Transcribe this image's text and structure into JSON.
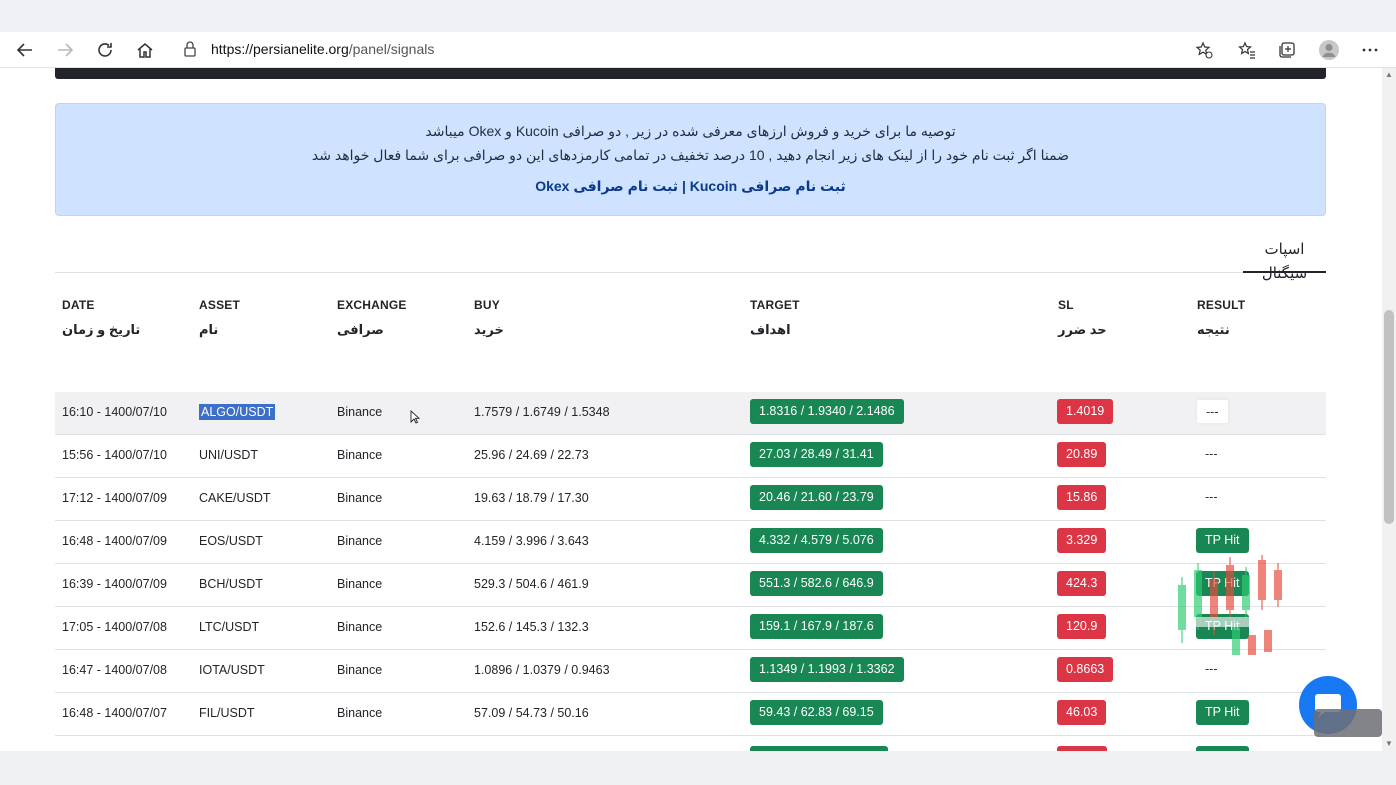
{
  "browser": {
    "url_host": "https://persianelite.org",
    "url_path": "/panel/signals"
  },
  "notice": {
    "line1": "توصیه ما برای خرید و فروش ارزهای معرفی شده در زیر , دو صرافی Kucoin و Okex میباشد",
    "line2": "ضمنا اگر ثبت نام خود را از لینک های زیر انجام دهید , 10 درصد تخفیف در تمامی کارمزدهای این دو صرافی برای شما فعال خواهد شد",
    "link_kucoin": "ثبت نام صرافی Kucoin",
    "separator": "|",
    "link_okex": "ثبت نام صرافی Okex"
  },
  "tab": {
    "label": "اسپات سیگنال"
  },
  "columns": [
    {
      "en": "DATE",
      "fa": "تاریخ و زمان"
    },
    {
      "en": "ASSET",
      "fa": "نام"
    },
    {
      "en": "EXCHANGE",
      "fa": "صرافی"
    },
    {
      "en": "BUY",
      "fa": "خرید"
    },
    {
      "en": "TARGET",
      "fa": "اهداف"
    },
    {
      "en": "SL",
      "fa": "حد ضرر"
    },
    {
      "en": "RESULT",
      "fa": "نتیجه"
    }
  ],
  "rows": [
    {
      "date": "16:10 - 1400/07/10",
      "asset": "ALGO/USDT",
      "exchange": "Binance",
      "buy": "1.7579 / 1.6749 / 1.5348",
      "target": "1.8316 / 1.9340 / 2.1486",
      "sl": "1.4019",
      "result": "---"
    },
    {
      "date": "15:56 - 1400/07/10",
      "asset": "UNI/USDT",
      "exchange": "Binance",
      "buy": "25.96 / 24.69 / 22.73",
      "target": "27.03 / 28.49 / 31.41",
      "sl": "20.89",
      "result": "---"
    },
    {
      "date": "17:12 - 1400/07/09",
      "asset": "CAKE/USDT",
      "exchange": "Binance",
      "buy": "19.63 / 18.79 / 17.30",
      "target": "20.46 / 21.60 / 23.79",
      "sl": "15.86",
      "result": "---"
    },
    {
      "date": "16:48 - 1400/07/09",
      "asset": "EOS/USDT",
      "exchange": "Binance",
      "buy": "4.159 / 3.996 / 3.643",
      "target": "4.332 / 4.579 / 5.076",
      "sl": "3.329",
      "result": "TP Hit"
    },
    {
      "date": "16:39 - 1400/07/09",
      "asset": "BCH/USDT",
      "exchange": "Binance",
      "buy": "529.3 / 504.6 / 461.9",
      "target": "551.3 / 582.6 / 646.9",
      "sl": "424.3",
      "result": "TP Hit"
    },
    {
      "date": "17:05 - 1400/07/08",
      "asset": "LTC/USDT",
      "exchange": "Binance",
      "buy": "152.6 / 145.3 / 132.3",
      "target": "159.1 / 167.9 / 187.6",
      "sl": "120.9",
      "result": "TP Hit"
    },
    {
      "date": "16:47 - 1400/07/08",
      "asset": "IOTA/USDT",
      "exchange": "Binance",
      "buy": "1.0896 / 1.0379 / 0.9463",
      "target": "1.1349 / 1.1993 / 1.3362",
      "sl": "0.8663",
      "result": "---"
    },
    {
      "date": "16:48 - 1400/07/07",
      "asset": "FIL/USDT",
      "exchange": "Binance",
      "buy": "57.09 / 54.73 / 50.16",
      "target": "59.43 / 62.83 / 69.15",
      "sl": "46.03",
      "result": "TP Hit"
    }
  ],
  "colors": {
    "green": "#198754",
    "red": "#dc3545",
    "notice_bg": "#cfe2ff",
    "selection": "#3b6fc9"
  },
  "icons": {
    "back": "back-arrow-icon",
    "forward": "forward-arrow-icon",
    "reload": "reload-icon",
    "home": "home-icon",
    "lock": "lock-icon",
    "favorite_add": "star-add-icon",
    "favorites": "favorites-icon",
    "collections": "collections-icon",
    "profile": "profile-icon",
    "menu": "more-icon"
  }
}
